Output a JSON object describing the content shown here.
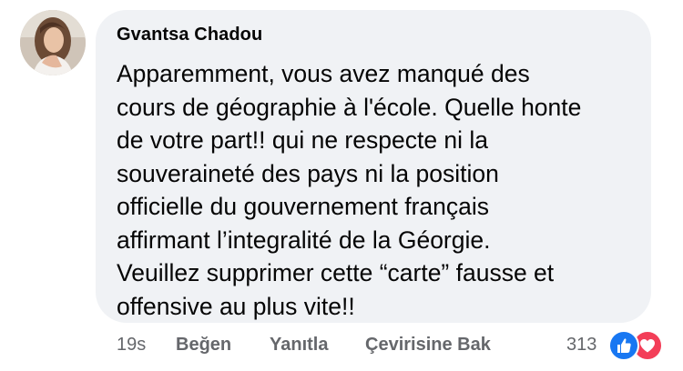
{
  "comment": {
    "author": "Gvantsa Chadou",
    "lines": [
      "Apparemment, vous avez manqué des",
      "cours de géographie à l'école. Quelle honte",
      "de votre part!! qui ne respecte ni la",
      "souveraineté des pays ni la position",
      "officielle du gouvernement français",
      "affirmant l’integralité de la Géorgie.",
      "Veuillez supprimer cette “carte” fausse et",
      "offensive au plus vite!!"
    ]
  },
  "meta": {
    "time": "19s",
    "like_label": "Beğen",
    "reply_label": "Yanıtla",
    "translate_label": "Çevirisine Bak",
    "reaction_count": "313"
  },
  "reactions": [
    "like-icon",
    "love-icon"
  ],
  "colors": {
    "bubble": "#f0f2f5",
    "meta_text": "#65676b",
    "like": "#1877f2",
    "love": "#f33e58"
  }
}
